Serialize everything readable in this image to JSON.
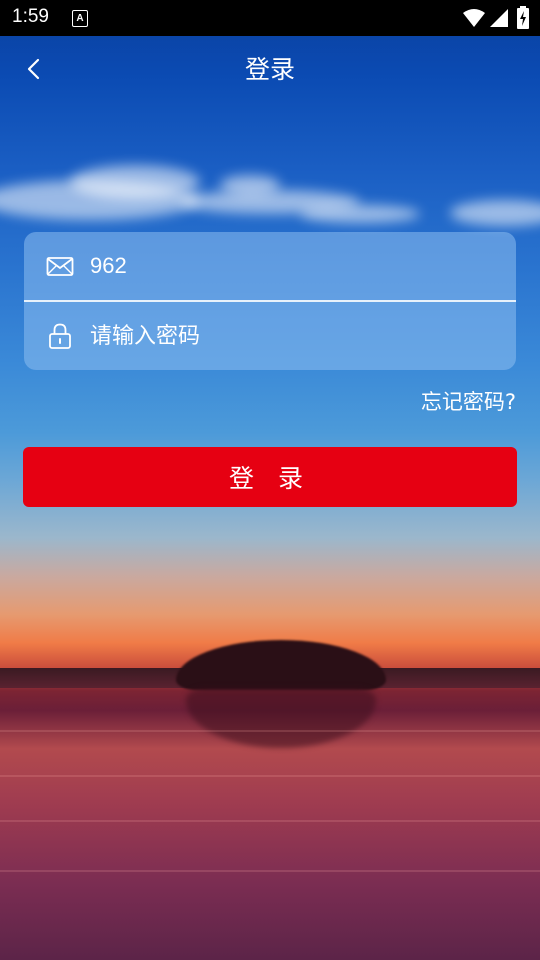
{
  "status_bar": {
    "time": "1:59",
    "notification_icon": "A"
  },
  "nav": {
    "title": "登录"
  },
  "form": {
    "username_value": "962",
    "password_placeholder": "请输入密码"
  },
  "forgot_password": "忘记密码?",
  "login_button": "登 录",
  "colors": {
    "login_button": "#e60012",
    "text": "#ffffff"
  },
  "icons": [
    "back-arrow-icon",
    "mail-icon",
    "lock-icon",
    "wifi-icon",
    "signal-icon",
    "battery-icon"
  ]
}
